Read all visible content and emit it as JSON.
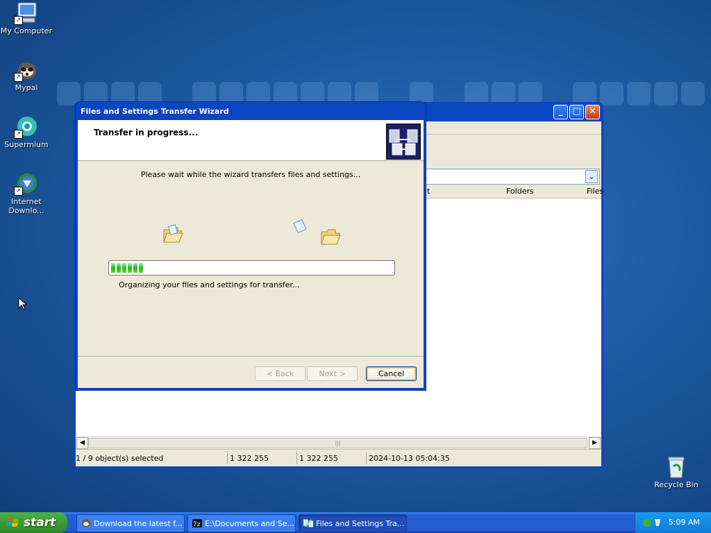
{
  "desktop": {
    "icons": [
      {
        "label": "My Computer",
        "icon": "computer-icon"
      },
      {
        "label": "Mypal",
        "icon": "mypal-raccoon-icon"
      },
      {
        "label": "Supermium",
        "icon": "supermium-browser-icon"
      },
      {
        "label": "Internet Downlo...",
        "icon": "internet-download-manager-icon"
      },
      {
        "label": "Recycle Bin",
        "icon": "recycle-bin-icon"
      }
    ]
  },
  "explorer": {
    "columns": [
      "t",
      "Folders",
      "Files"
    ],
    "status": {
      "selection": "1 / 9 object(s) selected",
      "size1": "1 322 255",
      "size2": "1 322 255",
      "modified": "2024-10-13 05:04:35"
    }
  },
  "wizard": {
    "title": "Files and Settings Transfer Wizard",
    "header": "Transfer in progress...",
    "message": "Please wait while the wizard transfers files and settings...",
    "progress": 0.12,
    "progress_text": "Organizing your files and settings for transfer...",
    "buttons": {
      "back": "< Back",
      "next": "Next >",
      "cancel": "Cancel"
    }
  },
  "taskbar": {
    "start_label": "start",
    "tasks": [
      {
        "label": "Download the latest f...",
        "icon": "raccoon-icon"
      },
      {
        "label": "E:\\Documents and Se...",
        "icon": "7zip-icon"
      },
      {
        "label": "Files and Settings Tra...",
        "icon": "transfer-wizard-icon"
      }
    ],
    "clock": "5:09 AM"
  },
  "colors": {
    "xp_blue": "#0a45c2",
    "start_green": "#3c9b36",
    "progress_green": "#2bb61b"
  }
}
